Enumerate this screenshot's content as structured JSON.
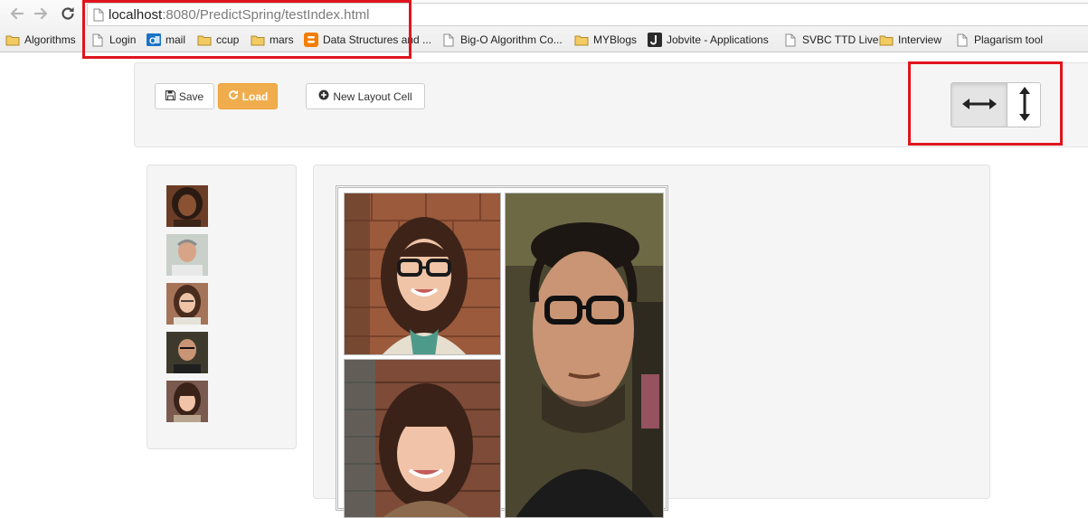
{
  "browser": {
    "nav": {
      "back_icon": "back-arrow-icon",
      "forward_icon": "forward-arrow-icon",
      "reload_icon": "reload-icon"
    },
    "url_host": "localhost",
    "url_rest": ":8080/PredictSpring/testIndex.html"
  },
  "bookmarks": [
    {
      "label": "Algorithms",
      "icon": "folder-icon"
    },
    {
      "label": "Login",
      "icon": "page-icon"
    },
    {
      "label": "mail",
      "icon": "outlook-icon"
    },
    {
      "label": "ccup",
      "icon": "folder-icon"
    },
    {
      "label": "mars",
      "icon": "folder-icon"
    },
    {
      "label": "Data Structures and ...",
      "icon": "blogger-icon"
    },
    {
      "label": "Big-O Algorithm Co...",
      "icon": "page-icon"
    },
    {
      "label": "MYBlogs",
      "icon": "folder-icon"
    },
    {
      "label": "Jobvite - Applications",
      "icon": "jobvite-icon"
    },
    {
      "label": "SVBC TTD Live",
      "icon": "page-icon"
    },
    {
      "label": "Interview",
      "icon": "folder-icon"
    },
    {
      "label": "Plagarism tool",
      "icon": "page-icon"
    }
  ],
  "toolbar": {
    "save_label": "Save",
    "load_label": "Load",
    "new_cell_label": "New Layout Cell",
    "orientation": {
      "options": [
        "horizontal",
        "vertical"
      ],
      "selected": "horizontal"
    }
  },
  "sidebar": {
    "thumbnails": [
      {
        "name": "person-1"
      },
      {
        "name": "person-2"
      },
      {
        "name": "person-3"
      },
      {
        "name": "person-4"
      },
      {
        "name": "person-5"
      }
    ]
  },
  "layout": {
    "cells": [
      {
        "name": "cell-top-left"
      },
      {
        "name": "cell-right"
      },
      {
        "name": "cell-bottom-left"
      }
    ]
  },
  "colors": {
    "annotation_red": "#e0141e",
    "load_button": "#f0ad4e",
    "folder": "#e8b94a"
  }
}
